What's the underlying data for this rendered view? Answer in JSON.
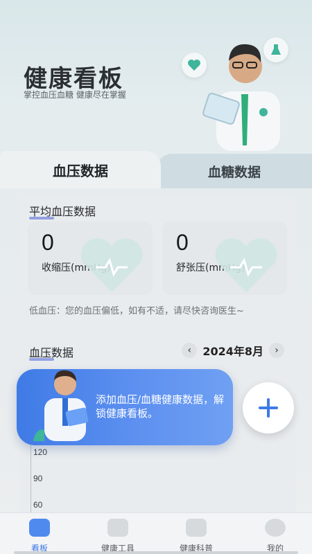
{
  "header": {
    "title": "健康看板",
    "subtitle": "掌控血压血糖 健康尽在掌握"
  },
  "tabs": [
    {
      "label": "血压数据",
      "active": true
    },
    {
      "label": "血糖数据",
      "active": false
    }
  ],
  "avg_bp": {
    "title": "平均血压数据",
    "systolic": {
      "value": "0",
      "label": "收缩压(mmHg)"
    },
    "diastolic": {
      "value": "0",
      "label": "舒张压(mmHg)"
    },
    "hint": "低血压：您的血压偏低，如有不适，请尽快咨询医生~"
  },
  "bp_data": {
    "title": "血压数据",
    "month": "2024年8月",
    "prev_icon": "chevron-left-icon",
    "next_icon": "chevron-right-icon",
    "y_ticks": [
      "120",
      "90",
      "60"
    ]
  },
  "prompt": {
    "text": "添加血压/血糖健康数据，解锁健康看板。",
    "add_icon": "plus-icon"
  },
  "nav": [
    {
      "label": "看板",
      "icon": "dashboard-icon",
      "active": true
    },
    {
      "label": "健康工具",
      "icon": "toolbox-icon",
      "active": false
    },
    {
      "label": "健康科普",
      "icon": "document-icon",
      "active": false
    },
    {
      "label": "我的",
      "icon": "profile-icon",
      "active": false
    }
  ],
  "colors": {
    "accent": "#3d7ae6",
    "prompt_bg": "#4f88ec"
  }
}
